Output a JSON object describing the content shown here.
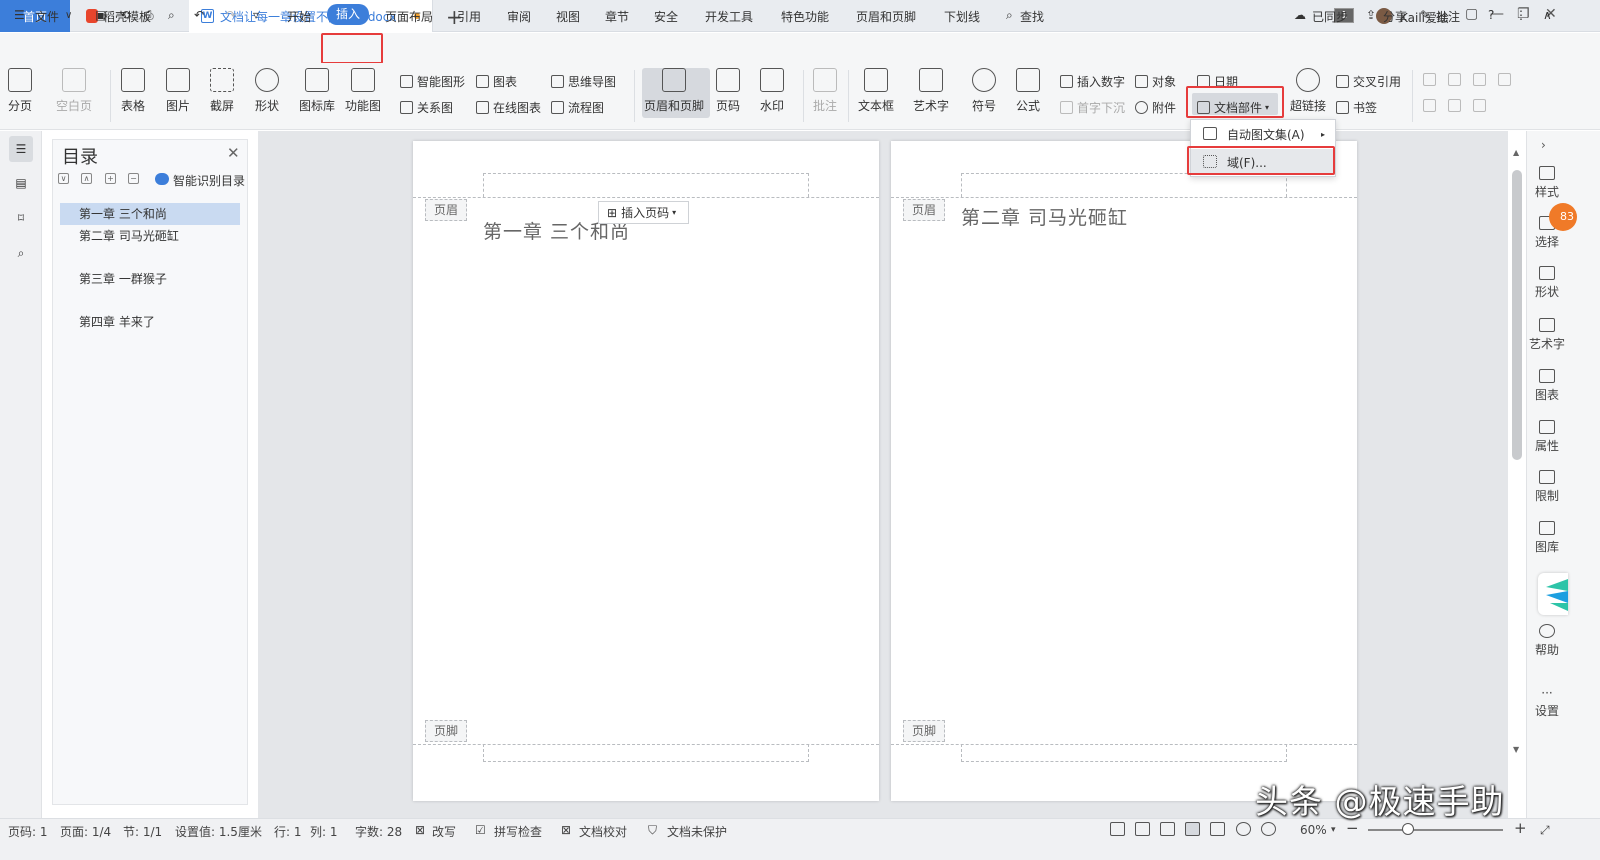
{
  "tabs": {
    "home": "首页",
    "templates": "稻壳模板",
    "document": "文档让每一章设置不同页眉.docx",
    "page_badge": "1",
    "user": "Kaili爱绘"
  },
  "menu": {
    "file": "文件",
    "items": [
      "开始",
      "插入",
      "页面布局",
      "引用",
      "审阅",
      "视图",
      "章节",
      "安全",
      "开发工具",
      "特色功能",
      "页眉和页脚",
      "下划线",
      "查找"
    ],
    "right": {
      "sync": "已同步",
      "share": "分享",
      "comment": "批注"
    }
  },
  "ribbon": {
    "page_break": "分页",
    "blank_page": "空白页",
    "table": "表格",
    "picture": "图片",
    "screenshot": "截屏",
    "shape": "形状",
    "icon_lib": "图标库",
    "func_chart": "功能图",
    "smart_shape": "智能图形",
    "chart": "图表",
    "mind_map": "思维导图",
    "relation": "关系图",
    "online_chart": "在线图表",
    "flowchart": "流程图",
    "header_footer": "页眉和页脚",
    "page_number": "页码",
    "watermark": "水印",
    "comment": "批注",
    "textbox": "文本框",
    "wordart": "艺术字",
    "symbol": "符号",
    "formula": "公式",
    "insert_number": "插入数字",
    "object": "对象",
    "date": "日期",
    "drop_cap": "首字下沉",
    "attachment": "附件",
    "doc_parts": "文档部件",
    "hyperlink": "超链接",
    "cross_ref": "交叉引用",
    "bookmark": "书签"
  },
  "dropdown": {
    "auto_text": "自动图文集(A)",
    "field": "域(F)..."
  },
  "toc": {
    "title": "目录",
    "smart": "智能识别目录",
    "items": [
      "第一章  三个和尚",
      "第二章  司马光砸缸",
      "第三章  一群猴子",
      "第四章  羊来了"
    ]
  },
  "pages": {
    "header_tag": "页眉",
    "footer_tag": "页脚",
    "insert_page_number": "插入页码",
    "chapter1": "第一章  三个和尚",
    "chapter2": "第二章  司马光砸缸"
  },
  "rightbar": {
    "style": "样式",
    "select": "选择",
    "shape": "形状",
    "wordart": "艺术字",
    "chart": "图表",
    "property": "属性",
    "limit": "限制",
    "gallery": "图库",
    "help": "帮助",
    "settings": "设置",
    "badge": "83"
  },
  "status": {
    "page": "页码: 1",
    "pages": "页面: 1/4",
    "section": "节: 1/1",
    "setting": "设置值: 1.5厘米",
    "row": "行: 1",
    "col": "列: 1",
    "words": "字数: 28",
    "revise": "改写",
    "spell": "拼写检查",
    "proof": "文档校对",
    "protect": "文档未保护",
    "zoom": "60%"
  },
  "watermark": "头条 @极速手助",
  "colors": {
    "accent": "#3c7eda",
    "highlight_box": "#e63c3c",
    "badge": "#f07a28"
  }
}
